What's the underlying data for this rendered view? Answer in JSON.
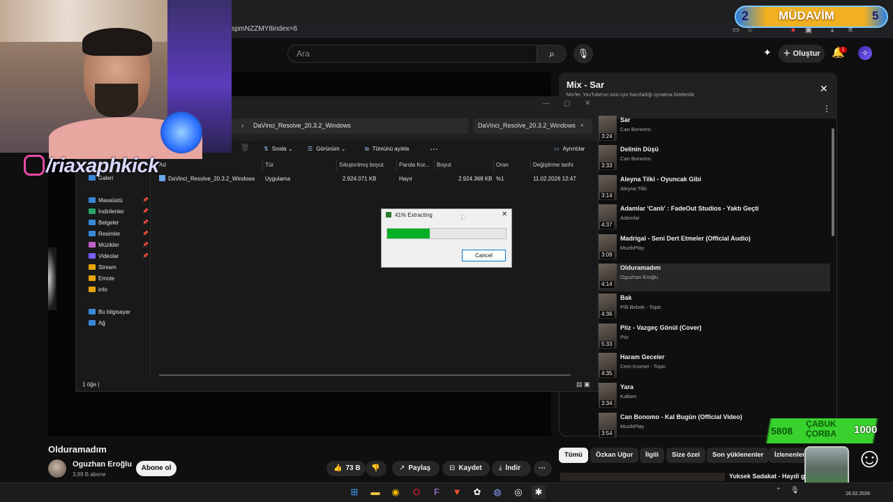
{
  "browser": {
    "url_fragment": "spmNZZMY8index=6"
  },
  "youtube": {
    "search_placeholder": "Ara",
    "create_label": "Oluştur",
    "notification_count": "1",
    "player": {
      "video_title": "Olduramadım",
      "channel_name": "Oguzhan Eroğlu",
      "channel_subs": "3,99 B abone",
      "subscribe_label": "Abone ol",
      "like_count": "73 B",
      "share_label": "Paylaş",
      "save_label": "Kaydet",
      "download_label": "İndir"
    },
    "mix": {
      "title": "Mix - Sar",
      "subtitle": "Mix'ler, YouTube'un sizin için hazırladığı oynatma listeleridir",
      "items": [
        {
          "title": "Sar",
          "channel": "Can Bonomo",
          "duration": "3:24"
        },
        {
          "title": "Delinin Düşü",
          "channel": "Can Bonomo",
          "duration": "3:33"
        },
        {
          "title": "Aleyna Tilki - Oyuncak Gibi",
          "channel": "Aleyna Tilki",
          "duration": "3:14"
        },
        {
          "title": "Adamlar 'Canlı' : FadeOut Studios - Yaktı Geçti",
          "channel": "Adamlar",
          "duration": "4:37"
        },
        {
          "title": "Madrigal - Seni Dert Etmeler (Official Audio)",
          "channel": "MuzikPlay",
          "duration": "3:09"
        },
        {
          "title": "Olduramadım",
          "channel": "Oguzhan Eroğlu",
          "duration": "4:14"
        },
        {
          "title": "Bak",
          "channel": "Pilli Bebek - Topic",
          "duration": "4:36"
        },
        {
          "title": "Piiz - Vazgeç Gönül (Cover)",
          "channel": "Piiz",
          "duration": "5:33"
        },
        {
          "title": "Haram Geceler",
          "channel": "Cem Kısmet - Topic",
          "duration": "4:35"
        },
        {
          "title": "Yara",
          "channel": "Kalben",
          "duration": "3:34"
        },
        {
          "title": "Can Bonomo - Kal Bugün (Official Video)",
          "channel": "MuzikPlay",
          "duration": "3:54"
        }
      ]
    },
    "chips": [
      "Tümü",
      "Özkan Uğur",
      "İlgili",
      "Size özel",
      "Son yüklenenler",
      "İzlenenler"
    ],
    "recommended_title": "Yuksek Sadakat - Haydi gel"
  },
  "explorer": {
    "breadcrumb_folder": "DaVinci_Resolve_20.3.2_Windows",
    "search_value": "DaVinci_Resolve_20.3.2_Windows",
    "toolbar": {
      "sort": "Sırala",
      "view": "Görünüm",
      "select_all": "Tümünü ayıkla",
      "details": "Ayrıntılar"
    },
    "sidebar": [
      {
        "label": "Galeri",
        "pinned": false
      },
      {
        "label": "Masaüstü",
        "pinned": true
      },
      {
        "label": "İndirilenler",
        "pinned": true
      },
      {
        "label": "Belgeler",
        "pinned": true
      },
      {
        "label": "Resimler",
        "pinned": true
      },
      {
        "label": "Müzikler",
        "pinned": true
      },
      {
        "label": "Videolar",
        "pinned": true
      },
      {
        "label": "Stream",
        "pinned": false
      },
      {
        "label": "Emote",
        "pinned": false
      },
      {
        "label": "info",
        "pinned": false
      },
      {
        "label": "Bu bilgisayar",
        "pinned": false
      },
      {
        "label": "Ağ",
        "pinned": false
      }
    ],
    "columns": [
      "Ad",
      "Tür",
      "Sıkıştırılmış boyut",
      "Parola Kor...",
      "Boyut",
      "Oran",
      "Değiştirme tarihi"
    ],
    "rows": [
      [
        "DaVinci_Resolve_20.3.2_Windows",
        "Uygulama",
        "2.924.071 KB",
        "Hayır",
        "2.924.368 KB",
        "%1",
        "11.02.2026 12:47"
      ]
    ],
    "status": "1 öğe"
  },
  "dialog": {
    "title": "41% Extracting",
    "progress": 0.36,
    "cancel_label": "Cancel"
  },
  "stream": {
    "handle": "/riaxaphkick",
    "badge_level": "2",
    "badge_name": "MÜDAVİM",
    "badge_count": "5",
    "green_number": "5808",
    "green_text_line1": "ÇABUK",
    "green_text_line2": "ÇORBA",
    "green_big": "1000"
  },
  "taskbar": {
    "date": "16.02.2026"
  },
  "colors": {
    "progress_green": "#06b025",
    "youtube_bg": "#0f0f0f",
    "accent_blue": "#0078d7"
  }
}
